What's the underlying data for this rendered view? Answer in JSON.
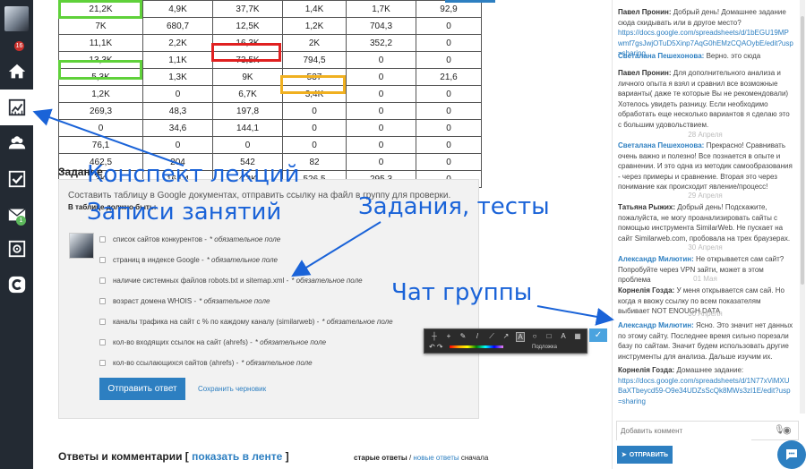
{
  "sidebar": {
    "avatar_badge": "16",
    "mail_badge": "1",
    "items": [
      {
        "icon": "home-icon"
      },
      {
        "icon": "chart-icon",
        "active": true
      },
      {
        "icon": "users-icon"
      },
      {
        "icon": "checkbox-icon"
      },
      {
        "icon": "mail-icon"
      },
      {
        "icon": "safe-icon"
      },
      {
        "icon": "c-logo-icon"
      }
    ]
  },
  "table": {
    "rows": [
      [
        "21,2K",
        "4,9K",
        "37,7K",
        "1,4K",
        "1,7K",
        "92,9"
      ],
      [
        "7K",
        "680,7",
        "12,5K",
        "1,2K",
        "704,3",
        "0"
      ],
      [
        "11,1K",
        "2,2K",
        "16,3K",
        "2K",
        "352,2",
        "0"
      ],
      [
        "13,3K",
        "1,1K",
        "73,5K",
        "794,5",
        "0",
        "0"
      ],
      [
        "5,3K",
        "1,3K",
        "9K",
        "537",
        "0",
        "21,6"
      ],
      [
        "1,2K",
        "0",
        "6,7K",
        "3,4K",
        "0",
        "0"
      ],
      [
        "269,3",
        "48,3",
        "197,8",
        "0",
        "0",
        "0"
      ],
      [
        "0",
        "34,6",
        "144,1",
        "0",
        "0",
        "0"
      ],
      [
        "76,1",
        "0",
        "0",
        "0",
        "0",
        "0"
      ],
      [
        "462,5",
        "204",
        "542",
        "82",
        "0",
        "0"
      ],
      [
        "3K",
        "164,4",
        "4,3K",
        "526,5",
        "295,3",
        "0"
      ]
    ]
  },
  "task": {
    "section_title": "Задание",
    "description": "Составить таблицу в Google документах, отправить ссылку на файл в группу для проверки.",
    "must_label": "В таблице должно быть:",
    "required_suffix": "* обязательное поле",
    "items": [
      "список сайтов конкурентов -",
      "страниц в индексе Google -",
      "наличие системных файлов robots.txt и sitemap.xml -",
      "возраст домена WHOIS -",
      "каналы трафика на сайт с % по каждому каналу (similarweb) -",
      "кол-во входящих ссылок на сайт (ahrefs) -",
      "кол-во ссылающихся сайтов (ahrefs) -"
    ],
    "submit_label": "Отправить ответ",
    "draft_label": "Сохранить черновик"
  },
  "answers": {
    "title": "Ответы и комментарии [",
    "link": "показать в ленте",
    "close": "]",
    "sort_old": "старые ответы",
    "sort_sep": " / ",
    "sort_new": "новые ответы",
    "sort_tail": " сначала"
  },
  "toolbar": {
    "label": "Подложка"
  },
  "annotations": {
    "lectures": "Конспект лекций",
    "recordings": "Записи занятий",
    "tasks": "Задания, тесты",
    "chat": "Чат группы",
    "color": "#1a63d8"
  },
  "chat": {
    "messages": [
      {
        "author": "Павел Пронин:",
        "text": "Добрый день! Домашнее задание сюда скидывать или в другое место?",
        "link": "https://docs.google.com/spreadsheets/d/1bEGU19MPwmf7gsJwjOTuD5Xinp7AqG0hEMzCQAOybE/edit?usp=sharing"
      },
      {
        "author": "Светалана Пешехонова:",
        "text": "Верно. это сюда"
      },
      {
        "author": "Павел Пронин:",
        "text": "Для дополнительного анализа и личного опыта я взял и сравнил все возможные варианты( даже те которые Вы не рекомендовали) Хотелось увидеть разницу. Если необходимо обработать еще несколько вариантов я сделаю это с большим удовольствием."
      },
      {
        "author": "Светалана Пешехонова:",
        "text": "Прекрасно! Сравнивать очень важно и полезно! Все познается в опыте и сравнении. И это одна из методик самообразования - через примеры и сравнение. Вторая это через понимание как происходит явление/процесс!"
      },
      {
        "author": "Татьяна Рыжих:",
        "text": "Добрый день! Подскажите, пожалуйста, не могу проанализировать сайты с помощью инструмента SimilarWeb. Не пускает на сайт Similarweb.com, пробовала на трех браузерах."
      },
      {
        "author": "Александр Милютин:",
        "text": "Не открывается сам сайт? Попробуйте через VPN зайти, может в этом проблема"
      },
      {
        "author": "Корнелія Гозда:",
        "text": "У меня открывается сам сай. Но когда я ввожу ссылку по всем показателям выбивает NOT ENOUGH DATA"
      },
      {
        "author": "Александр Милютин:",
        "text": "Ясно. Это значит нет данных по этому сайту. Последнее время сильно порезали базу по сайтам. Значит будем использовать другие инструменты для анализа. Дальше изучим их."
      },
      {
        "author": "Корнелія Гозда:",
        "text": "Домашнее задание:",
        "link": "https://docs.google.com/spreadsheets/d/1N77xViMXUBaXTbeycd59-O9e34UDZsScQk8MWs3zI1E/edit?usp=sharing"
      }
    ],
    "dates": [
      "28 Апреля",
      "29 Апреля",
      "30 Апреля",
      "01 Мая",
      "30 Апреля"
    ],
    "input_placeholder": "Добавить коммент",
    "send_label": "ОТПРАВИТЬ"
  }
}
